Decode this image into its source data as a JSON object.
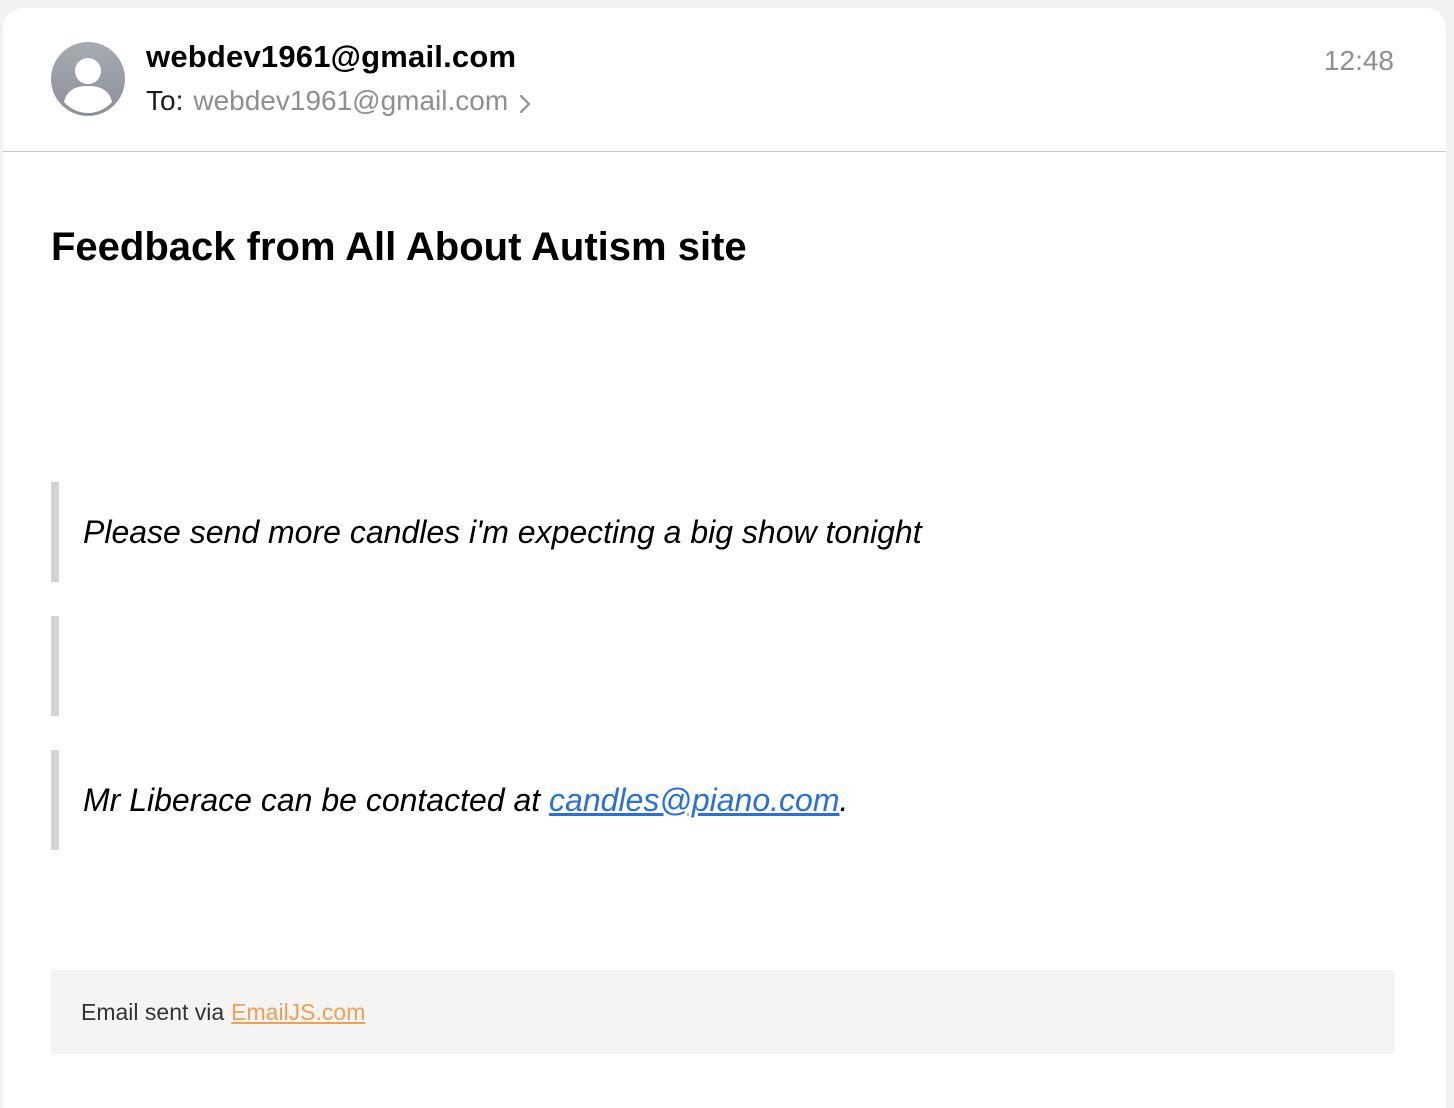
{
  "header": {
    "sender": "webdev1961@gmail.com",
    "to_label": "To:",
    "to_address": "webdev1961@gmail.com",
    "time": "12:48"
  },
  "subject": "Feedback from All About Autism site",
  "message": {
    "quote1": "Please send more candles i'm expecting a big show tonight",
    "quote2": "",
    "quote3_prefix": "Mr Liberace can be contacted at ",
    "quote3_link": "candles@piano.com",
    "quote3_suffix": "."
  },
  "footer": {
    "prefix": "Email sent via",
    "link": "EmailJS.com"
  },
  "colors": {
    "link_blue": "#2a6fdb",
    "footer_link_orange": "#f0a052",
    "quote_bar": "#d4d4d4"
  },
  "icons": {
    "avatar": "person-avatar-icon",
    "disclosure": "chevron-right-icon"
  }
}
